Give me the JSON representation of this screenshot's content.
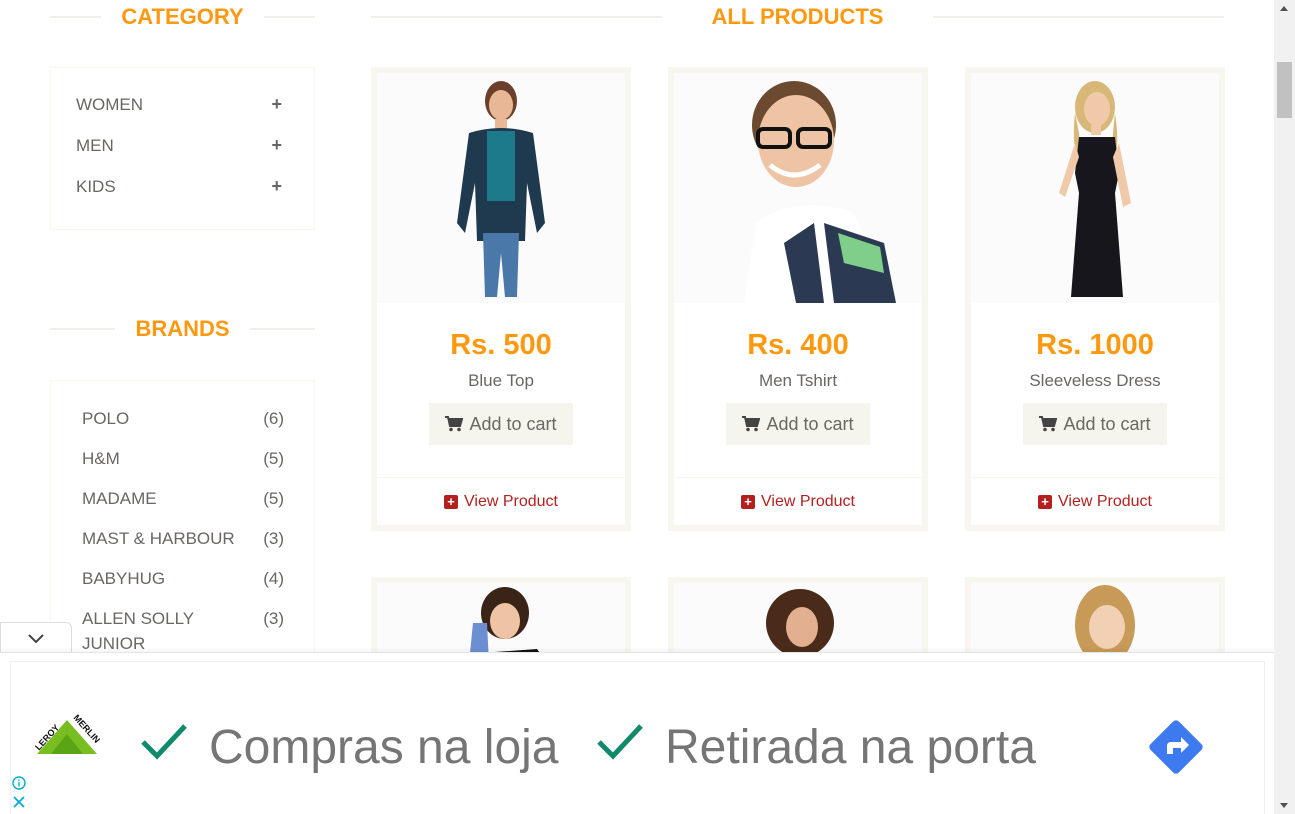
{
  "sidebar": {
    "category_title": "CATEGORY",
    "categories": [
      {
        "label": "WOMEN"
      },
      {
        "label": "MEN"
      },
      {
        "label": "KIDS"
      }
    ],
    "brands_title": "BRANDS",
    "brands": [
      {
        "name": "POLO",
        "count": "(6)"
      },
      {
        "name": "H&M",
        "count": "(5)"
      },
      {
        "name": "MADAME",
        "count": "(5)"
      },
      {
        "name": "MAST & HARBOUR",
        "count": "(3)"
      },
      {
        "name": "BABYHUG",
        "count": "(4)"
      },
      {
        "name": "ALLEN SOLLY JUNIOR",
        "count": "(3)"
      }
    ]
  },
  "main": {
    "title": "ALL PRODUCTS",
    "products": [
      {
        "price": "Rs. 500",
        "name": "Blue Top",
        "cart_label": "Add to cart",
        "view_label": "View Product"
      },
      {
        "price": "Rs. 400",
        "name": "Men Tshirt",
        "cart_label": "Add to cart",
        "view_label": "View Product"
      },
      {
        "price": "Rs. 1000",
        "name": "Sleeveless Dress",
        "cart_label": "Add to cart",
        "view_label": "View Product"
      }
    ]
  },
  "ad": {
    "text1": "Compras na loja",
    "text2": "Retirada na porta",
    "brand": "LEROY MERLIN"
  },
  "colors": {
    "accent": "#fe980f",
    "text": "#696763",
    "link": "#b3211f",
    "check": "#0f8a6b",
    "direction": "#3d7af0"
  }
}
